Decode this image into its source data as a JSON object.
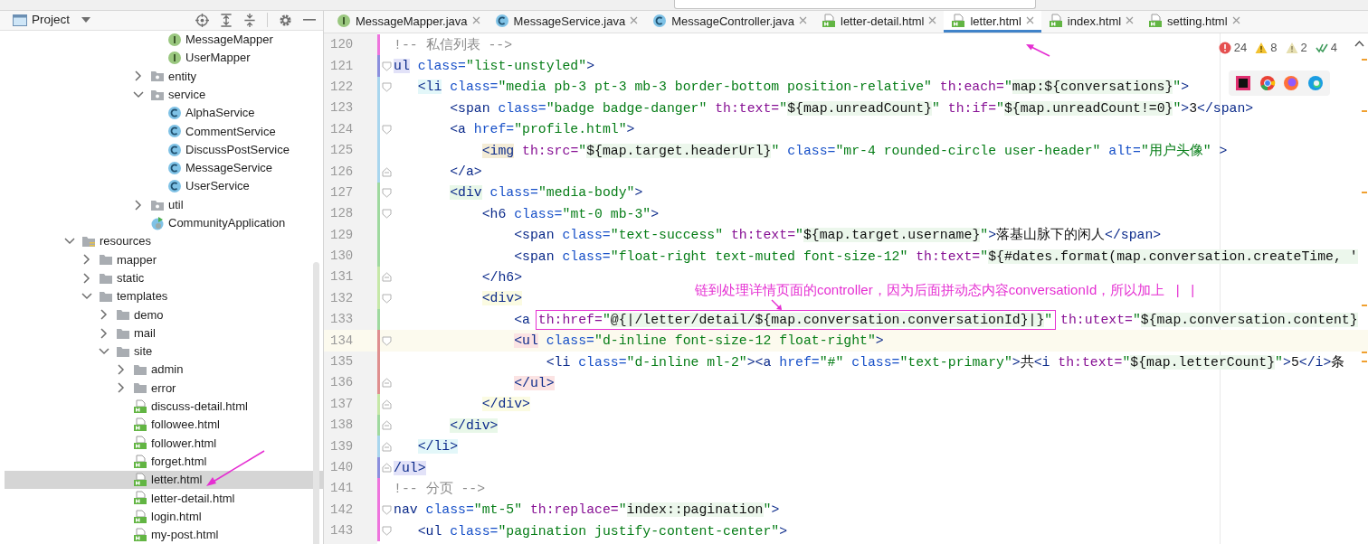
{
  "project_panel": {
    "title": "Project"
  },
  "tree": [
    {
      "children": [
        {
          "children": [
            {
              "children": [
                {
                  "children": [
                    {
                      "children": [
                        {
                          "label": "MessageMapper",
                          "kind": "interface",
                          "selected": false
                        },
                        {
                          "label": "UserMapper",
                          "kind": "interface",
                          "selected": false
                        }
                      ]
                    },
                    {
                      "label": "entity",
                      "kind": "package",
                      "expanded": false,
                      "selected": false
                    },
                    {
                      "label": "service",
                      "kind": "package",
                      "expanded": true,
                      "selected": false,
                      "children": [
                        {
                          "label": "AlphaService",
                          "kind": "class",
                          "selected": false
                        },
                        {
                          "label": "CommentService",
                          "kind": "class",
                          "selected": false
                        },
                        {
                          "label": "DiscussPostService",
                          "kind": "class",
                          "selected": false
                        },
                        {
                          "label": "MessageService",
                          "kind": "class",
                          "selected": false
                        },
                        {
                          "label": "UserService",
                          "kind": "class",
                          "selected": false
                        }
                      ]
                    },
                    {
                      "label": "util",
                      "kind": "package",
                      "expanded": false,
                      "selected": false
                    },
                    {
                      "label": "CommunityApplication",
                      "kind": "app",
                      "selected": false
                    }
                  ]
                }
              ]
            }
          ]
        }
      ]
    },
    {
      "label": "resources",
      "kind": "resources",
      "expanded": true,
      "selected": false,
      "children": [
        {
          "label": "mapper",
          "kind": "folder",
          "expanded": false,
          "selected": false
        },
        {
          "label": "static",
          "kind": "folder",
          "expanded": false,
          "selected": false
        },
        {
          "label": "templates",
          "kind": "folder",
          "expanded": true,
          "selected": false,
          "children": [
            {
              "label": "demo",
              "kind": "folder",
              "expanded": false,
              "selected": false
            },
            {
              "label": "mail",
              "kind": "folder",
              "expanded": false,
              "selected": false
            },
            {
              "label": "site",
              "kind": "folder",
              "expanded": true,
              "selected": false,
              "children": [
                {
                  "label": "admin",
                  "kind": "folder",
                  "expanded": false,
                  "selected": false
                },
                {
                  "label": "error",
                  "kind": "folder",
                  "expanded": false,
                  "selected": false
                },
                {
                  "label": "discuss-detail.html",
                  "kind": "html",
                  "selected": false
                },
                {
                  "label": "followee.html",
                  "kind": "html",
                  "selected": false
                },
                {
                  "label": "follower.html",
                  "kind": "html",
                  "selected": false
                },
                {
                  "label": "forget.html",
                  "kind": "html",
                  "selected": false
                },
                {
                  "label": "letter.html",
                  "kind": "html",
                  "selected": true
                },
                {
                  "label": "letter-detail.html",
                  "kind": "html",
                  "selected": false
                },
                {
                  "label": "login.html",
                  "kind": "html",
                  "selected": false
                },
                {
                  "label": "my-post.html",
                  "kind": "html",
                  "selected": false
                }
              ]
            }
          ]
        }
      ]
    }
  ],
  "tabs": [
    {
      "label": "MessageMapper.java",
      "kind": "interface",
      "selected": false
    },
    {
      "label": "MessageService.java",
      "kind": "class",
      "selected": false
    },
    {
      "label": "MessageController.java",
      "kind": "class",
      "selected": false
    },
    {
      "label": "letter-detail.html",
      "kind": "html",
      "selected": false
    },
    {
      "label": "letter.html",
      "kind": "html",
      "selected": true
    },
    {
      "label": "index.html",
      "kind": "html",
      "selected": false
    },
    {
      "label": "setting.html",
      "kind": "html",
      "selected": false
    }
  ],
  "inspections": [
    {
      "kind": "error",
      "count": "24"
    },
    {
      "kind": "warning",
      "count": "8"
    },
    {
      "kind": "weak",
      "count": "2"
    },
    {
      "kind": "typo",
      "count": "4"
    }
  ],
  "annotation": {
    "text": "链到处理详情页面的controller，因为后面拼动态内容conversationId，所以加上   |   |"
  },
  "code": [
    {
      "number": "120",
      "color": "#ee74dd",
      "kind": "plain",
      "tokens": [
        {
          "kind": "comment",
          "text": "!-- 私信列表 -->"
        }
      ]
    },
    {
      "number": "121",
      "color": "#8b8fdd",
      "kind": "fold-start",
      "tokens": [
        {
          "kind": "tag",
          "text": "ul",
          "color": "#e2e2f8"
        },
        {
          "kind": "attr",
          "text": " class="
        },
        {
          "kind": "string",
          "text": "\"list-unstyled\""
        },
        {
          "kind": "tag",
          "text": ">"
        }
      ]
    },
    {
      "number": "122",
      "color": "#a9d6ee",
      "kind": "fold-start",
      "tokens": [
        {
          "kind": "tag",
          "text": "   <li",
          "color": "#e3f7f9"
        },
        {
          "kind": "attr",
          "text": " class="
        },
        {
          "kind": "string",
          "text": "\"media pb-3 pt-3 mb-3 border-bottom position-relative\""
        },
        {
          "kind": "th",
          "text": " th:each="
        },
        {
          "kind": "string",
          "text": "\""
        },
        {
          "kind": "expr",
          "text": "map:${conversations}"
        },
        {
          "kind": "string",
          "text": "\""
        },
        {
          "kind": "tag",
          "text": ">"
        }
      ]
    },
    {
      "number": "123",
      "color": "#a9d6ee",
      "kind": "plain",
      "tokens": [
        {
          "kind": "tag",
          "text": "       <span"
        },
        {
          "kind": "attr",
          "text": " class="
        },
        {
          "kind": "string",
          "text": "\"badge badge-danger\""
        },
        {
          "kind": "th",
          "text": " th:text="
        },
        {
          "kind": "string",
          "text": "\""
        },
        {
          "kind": "expr",
          "text": "${map.unreadCount}"
        },
        {
          "kind": "string",
          "text": "\""
        },
        {
          "kind": "th",
          "text": " th:if="
        },
        {
          "kind": "string",
          "text": "\""
        },
        {
          "kind": "expr",
          "text": "${map.unreadCount!=0}"
        },
        {
          "kind": "string",
          "text": "\""
        },
        {
          "kind": "tag",
          "text": ">"
        },
        {
          "kind": "text",
          "text": "3"
        },
        {
          "kind": "tag",
          "text": "</span>"
        }
      ]
    },
    {
      "number": "124",
      "color": "#a9d6ee",
      "kind": "fold-start",
      "tokens": [
        {
          "kind": "tag",
          "text": "       <a"
        },
        {
          "kind": "attr",
          "text": " href="
        },
        {
          "kind": "string",
          "text": "\"profile.html\""
        },
        {
          "kind": "tag",
          "text": ">"
        }
      ]
    },
    {
      "number": "125",
      "color": "#a9d6ee",
      "kind": "plain",
      "tokens": [
        {
          "kind": "tag",
          "text": "           <img",
          "color": "#f4ecd6"
        },
        {
          "kind": "th",
          "text": " th:src="
        },
        {
          "kind": "string",
          "text": "\""
        },
        {
          "kind": "expr",
          "text": "${map.target.headerUrl}"
        },
        {
          "kind": "string",
          "text": "\""
        },
        {
          "kind": "attr",
          "text": " class="
        },
        {
          "kind": "string",
          "text": "\"mr-4 rounded-circle user-header\""
        },
        {
          "kind": "attr",
          "text": " alt="
        },
        {
          "kind": "string",
          "text": "\"用户头像\""
        },
        {
          "kind": "tag",
          "text": " >"
        }
      ]
    },
    {
      "number": "126",
      "color": "#a9d6ee",
      "kind": "fold-end",
      "tokens": [
        {
          "kind": "tag",
          "text": "       </a>"
        }
      ]
    },
    {
      "number": "127",
      "color": "#9fd99f",
      "kind": "fold-start",
      "tokens": [
        {
          "kind": "tag",
          "text": "       <div",
          "color": "#e8f7e8"
        },
        {
          "kind": "attr",
          "text": " class="
        },
        {
          "kind": "string",
          "text": "\"media-body\""
        },
        {
          "kind": "tag",
          "text": ">"
        }
      ]
    },
    {
      "number": "128",
      "color": "#9fd99f",
      "kind": "fold-start",
      "tokens": [
        {
          "kind": "tag",
          "text": "           <h6"
        },
        {
          "kind": "attr",
          "text": " class="
        },
        {
          "kind": "string",
          "text": "\"mt-0 mb-3\""
        },
        {
          "kind": "tag",
          "text": ">"
        }
      ]
    },
    {
      "number": "129",
      "color": "#9fd99f",
      "kind": "plain",
      "tokens": [
        {
          "kind": "tag",
          "text": "               <span"
        },
        {
          "kind": "attr",
          "text": " class="
        },
        {
          "kind": "string",
          "text": "\"text-success\""
        },
        {
          "kind": "th",
          "text": " th:text="
        },
        {
          "kind": "string",
          "text": "\""
        },
        {
          "kind": "expr",
          "text": "${map.target.username}"
        },
        {
          "kind": "string",
          "text": "\""
        },
        {
          "kind": "tag",
          "text": ">"
        },
        {
          "kind": "text",
          "text": "落基山脉下的闲人"
        },
        {
          "kind": "tag",
          "text": "</span>"
        }
      ]
    },
    {
      "number": "130",
      "color": "#9fd99f",
      "kind": "plain",
      "tokens": [
        {
          "kind": "tag",
          "text": "               <span"
        },
        {
          "kind": "attr",
          "text": " class="
        },
        {
          "kind": "string",
          "text": "\"float-right text-muted font-size-12\""
        },
        {
          "kind": "th",
          "text": " th:text="
        },
        {
          "kind": "string",
          "text": "\""
        },
        {
          "kind": "expr",
          "text": "${#dates.format(map.conversation.createTime, '"
        }
      ]
    },
    {
      "number": "131",
      "color": "#c6e8a8",
      "kind": "fold-end",
      "tokens": [
        {
          "kind": "tag",
          "text": "           </h6>"
        }
      ]
    },
    {
      "number": "132",
      "color": "#c6e8a8",
      "kind": "fold-start",
      "tokens": [
        {
          "kind": "tag",
          "text": "           <div>",
          "color": "#fbfbe2"
        }
      ]
    },
    {
      "number": "133",
      "color": "#9fd99f",
      "kind": "plain",
      "tokens": [
        {
          "kind": "tag",
          "text": "               <a "
        },
        {
          "kind": "th",
          "text": "th:href=",
          "boxed": true
        },
        {
          "kind": "string",
          "text": "\"",
          "boxed": true
        },
        {
          "kind": "expr",
          "text": "@{|/letter/detail/${map.conversation.conversationId}|}",
          "boxed": true
        },
        {
          "kind": "string",
          "text": "\"",
          "boxed": true
        },
        {
          "kind": "th",
          "text": " th:utext="
        },
        {
          "kind": "string",
          "text": "\""
        },
        {
          "kind": "expr",
          "text": "${map.conversation.content}"
        }
      ]
    },
    {
      "number": "134",
      "color": "#df8f8f",
      "kind": "fold-start",
      "current": true,
      "tokens": [
        {
          "kind": "tag",
          "text": "               <ul",
          "color": "#fbe3e3"
        },
        {
          "kind": "attr",
          "text": " class="
        },
        {
          "kind": "string",
          "text": "\"d-inline font-size-12 float-right\""
        },
        {
          "kind": "tag",
          "text": ">"
        }
      ]
    },
    {
      "number": "135",
      "color": "#df8f8f",
      "kind": "plain",
      "tokens": [
        {
          "kind": "tag",
          "text": "                   <li"
        },
        {
          "kind": "attr",
          "text": " class="
        },
        {
          "kind": "string",
          "text": "\"d-inline ml-2\""
        },
        {
          "kind": "tag",
          "text": "><a"
        },
        {
          "kind": "attr",
          "text": " href="
        },
        {
          "kind": "string",
          "text": "\"#\""
        },
        {
          "kind": "attr",
          "text": " class="
        },
        {
          "kind": "string",
          "text": "\"text-primary\""
        },
        {
          "kind": "tag",
          "text": ">"
        },
        {
          "kind": "text",
          "text": "共"
        },
        {
          "kind": "tag",
          "text": "<i"
        },
        {
          "kind": "th",
          "text": " th:text="
        },
        {
          "kind": "string",
          "text": "\""
        },
        {
          "kind": "expr",
          "text": "${map.letterCount}"
        },
        {
          "kind": "string",
          "text": "\""
        },
        {
          "kind": "tag",
          "text": ">"
        },
        {
          "kind": "text",
          "text": "5"
        },
        {
          "kind": "tag",
          "text": "</i>"
        },
        {
          "kind": "text",
          "text": "条"
        }
      ]
    },
    {
      "number": "136",
      "color": "#df8f8f",
      "kind": "fold-end",
      "tokens": [
        {
          "kind": "tag",
          "text": "               </ul>",
          "color": "#fbe3e3"
        }
      ]
    },
    {
      "number": "137",
      "color": "#c6e8a8",
      "kind": "fold-end",
      "tokens": [
        {
          "kind": "tag",
          "text": "           </div>",
          "color": "#fbfbe2"
        }
      ]
    },
    {
      "number": "138",
      "color": "#9fd99f",
      "kind": "fold-end",
      "tokens": [
        {
          "kind": "tag",
          "text": "       </div>",
          "color": "#e8f7e8"
        }
      ]
    },
    {
      "number": "139",
      "color": "#a9d6ee",
      "kind": "fold-end",
      "tokens": [
        {
          "kind": "tag",
          "text": "   </li>",
          "color": "#e3f7f9"
        }
      ]
    },
    {
      "number": "140",
      "color": "#8b8fdd",
      "kind": "fold-end",
      "tokens": [
        {
          "kind": "tag",
          "text": "/ul>",
          "color": "#e2e2f8"
        }
      ]
    },
    {
      "number": "141",
      "color": "#ee74dd",
      "kind": "plain",
      "tokens": [
        {
          "kind": "comment",
          "text": "!-- 分页 -->"
        }
      ]
    },
    {
      "number": "142",
      "color": "#ee74dd",
      "kind": "fold-start",
      "tokens": [
        {
          "kind": "tag",
          "text": "nav"
        },
        {
          "kind": "attr",
          "text": " class="
        },
        {
          "kind": "string",
          "text": "\"mt-5\""
        },
        {
          "kind": "th",
          "text": " th:replace="
        },
        {
          "kind": "string",
          "text": "\""
        },
        {
          "kind": "expr",
          "text": "index::pagination"
        },
        {
          "kind": "string",
          "text": "\""
        },
        {
          "kind": "tag",
          "text": ">"
        }
      ]
    },
    {
      "number": "143",
      "color": "#ee74dd",
      "kind": "fold-start",
      "tokens": [
        {
          "kind": "tag",
          "text": "   <ul"
        },
        {
          "kind": "attr",
          "text": " class="
        },
        {
          "kind": "string",
          "text": "\"pagination justify-content-center\""
        },
        {
          "kind": "tag",
          "text": ">"
        }
      ]
    }
  ]
}
